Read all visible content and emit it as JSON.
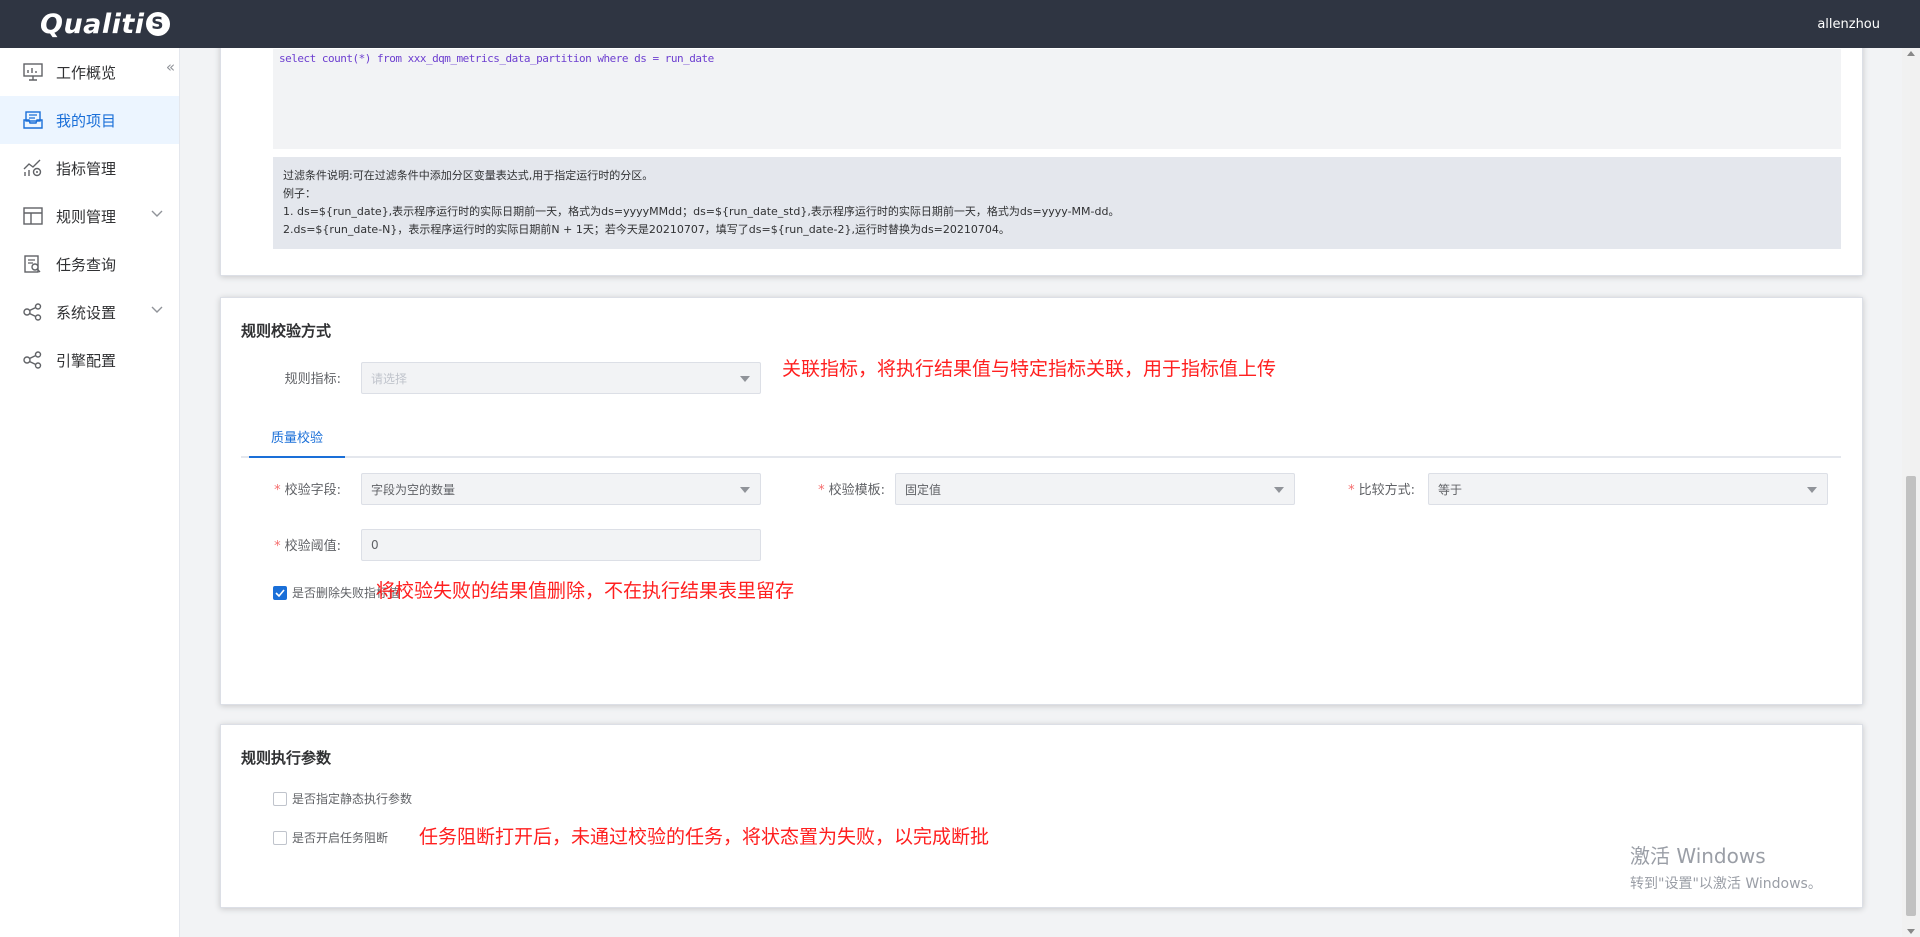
{
  "header": {
    "logo": "Qualiti",
    "logo_badge": "S",
    "user": "allenzhou"
  },
  "sidebar": {
    "collapse_icon": "double-chevron-left",
    "items": [
      {
        "label": "工作概览",
        "icon": "monitor-chart-icon",
        "active": false,
        "expandable": false
      },
      {
        "label": "我的项目",
        "icon": "inbox-icon",
        "active": true,
        "expandable": false
      },
      {
        "label": "指标管理",
        "icon": "metric-chart-icon",
        "active": false,
        "expandable": false
      },
      {
        "label": "规则管理",
        "icon": "layout-icon",
        "active": false,
        "expandable": true
      },
      {
        "label": "任务查询",
        "icon": "search-doc-icon",
        "active": false,
        "expandable": false
      },
      {
        "label": "系统设置",
        "icon": "share-icon",
        "active": false,
        "expandable": true
      },
      {
        "label": "引擎配置",
        "icon": "share-icon",
        "active": false,
        "expandable": false
      }
    ]
  },
  "filter": {
    "code_line": "select count(*) from xxx_dqm_metrics_data_partition where ds = run_date",
    "hint": {
      "line1": "过滤条件说明:可在过滤条件中添加分区变量表达式,用于指定运行时的分区。",
      "line2": "例子：",
      "line3": "1. ds=${run_date},表示程序运行时的实际日期前一天，格式为ds=yyyyMMdd；ds=${run_date_std},表示程序运行时的实际日期前一天，格式为ds=yyyy-MM-dd。",
      "line4": "2.ds=${run_date-N}，表示程序运行时的实际日期前N + 1天；若今天是20210707，填写了ds=${run_date-2},运行时替换为ds=20210704。"
    }
  },
  "validation": {
    "title": "规则校验方式",
    "metric_label": "规则指标:",
    "metric_placeholder": "请选择",
    "metric_annotation": "关联指标，将执行结果值与特定指标关联，用于指标值上传",
    "tab": "质量校验",
    "field_label": "校验字段:",
    "field_value": "字段为空的数量",
    "template_label": "校验模板:",
    "template_value": "固定值",
    "compare_label": "比较方式:",
    "compare_value": "等于",
    "threshold_label": "校验阈值:",
    "threshold_value": "0",
    "delete_checkbox_label": "是否删除失败指标值",
    "delete_checked": true,
    "delete_annotation": "将校验失败的结果值删除，不在执行结果表里留存"
  },
  "execution": {
    "title": "规则执行参数",
    "static_checkbox_label": "是否指定静态执行参数",
    "block_checkbox_label": "是否开启任务阻断",
    "block_annotation": "任务阻断打开后，未通过校验的任务，将状态置为失败，以完成断批"
  },
  "watermark": {
    "line1": "激活 Windows",
    "line2": "转到\"设置\"以激活 Windows。"
  },
  "colors": {
    "topbar": "#2f3542",
    "accent": "#1a6fd8",
    "annotation": "#ff1f1f",
    "required": "#f56c6c"
  }
}
